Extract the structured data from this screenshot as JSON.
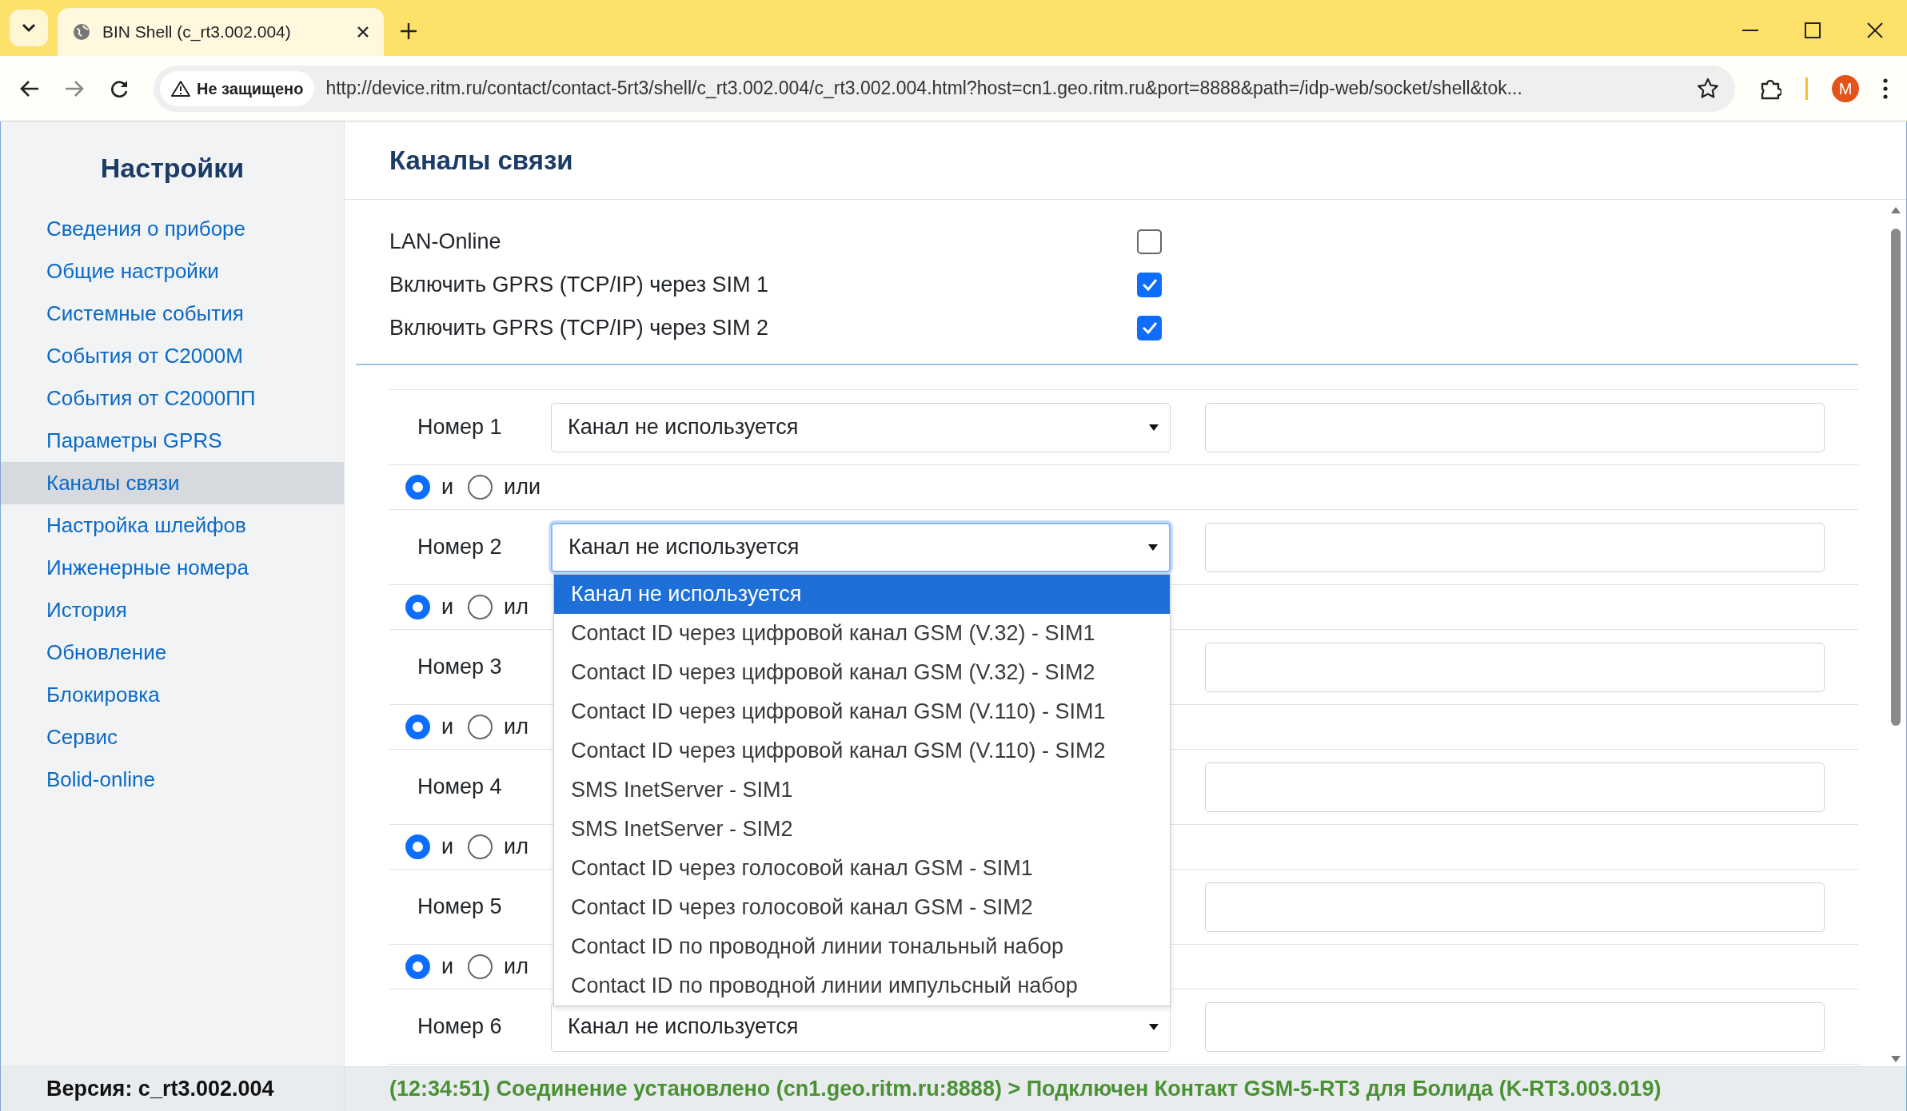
{
  "browser": {
    "tab_title": "BIN Shell (c_rt3.002.004)",
    "security": "Не защищено",
    "url": "http://device.ritm.ru/contact/contact-5rt3/shell/c_rt3.002.004/c_rt3.002.004.html?host=cn1.geo.ritm.ru&port=8888&path=/idp-web/socket/shell&tok...",
    "profile": "M"
  },
  "sidebar": {
    "title": "Настройки",
    "items": [
      {
        "label": "Сведения о приборе",
        "selected": false
      },
      {
        "label": "Общие настройки",
        "selected": false
      },
      {
        "label": "Системные события",
        "selected": false
      },
      {
        "label": "События от С2000М",
        "selected": false
      },
      {
        "label": "События от С2000ПП",
        "selected": false
      },
      {
        "label": "Параметры GPRS",
        "selected": false
      },
      {
        "label": "Каналы связи",
        "selected": true
      },
      {
        "label": "Настройка шлейфов",
        "selected": false
      },
      {
        "label": "Инженерные номера",
        "selected": false
      },
      {
        "label": "История",
        "selected": false
      },
      {
        "label": "Обновление",
        "selected": false
      },
      {
        "label": "Блокировка",
        "selected": false
      },
      {
        "label": "Сервис",
        "selected": false
      },
      {
        "label": "Bolid-online",
        "selected": false
      }
    ],
    "version": "Версия: c_rt3.002.004"
  },
  "page": {
    "title": "Каналы связи",
    "options": [
      {
        "label": "LAN-Online",
        "checked": false
      },
      {
        "label": "Включить GPRS (TCP/IP) через SIM 1",
        "checked": true
      },
      {
        "label": "Включить GPRS (TCP/IP) через SIM 2",
        "checked": true
      }
    ],
    "numbers": [
      {
        "label": "Номер 1",
        "select": {
          "value": "Канал не используется",
          "open": false
        },
        "logic": [
          {
            "label": "и",
            "selected": true
          },
          {
            "label": "или",
            "selected": false
          }
        ]
      },
      {
        "label": "Номер 2",
        "select": {
          "value": "Канал не используется",
          "open": true,
          "options": [
            {
              "label": "Канал не используется",
              "selected": true
            },
            {
              "label": "Contact ID через цифровой канал GSM (V.32) - SIM1",
              "selected": false
            },
            {
              "label": "Contact ID через цифровой канал GSM (V.32) - SIM2",
              "selected": false
            },
            {
              "label": "Contact ID через цифровой канал GSM (V.110) - SIM1",
              "selected": false
            },
            {
              "label": "Contact ID через цифровой канал GSM (V.110) - SIM2",
              "selected": false
            },
            {
              "label": "SMS InetServer - SIM1",
              "selected": false
            },
            {
              "label": "SMS InetServer - SIM2",
              "selected": false
            },
            {
              "label": "Contact ID через голосовой канал GSM - SIM1",
              "selected": false
            },
            {
              "label": "Contact ID через голосовой канал GSM - SIM2",
              "selected": false
            },
            {
              "label": "Contact ID по проводной линии тональный набор",
              "selected": false
            },
            {
              "label": "Contact ID по проводной линии импульсный набор",
              "selected": false
            }
          ]
        },
        "logic": [
          {
            "label": "и",
            "selected": true
          },
          {
            "label": "ил",
            "selected": false
          }
        ]
      },
      {
        "label": "Номер 3",
        "logic": [
          {
            "label": "и",
            "selected": true
          },
          {
            "label": "ил",
            "selected": false
          }
        ]
      },
      {
        "label": "Номер 4",
        "logic": [
          {
            "label": "и",
            "selected": true
          },
          {
            "label": "ил",
            "selected": false
          }
        ]
      },
      {
        "label": "Номер 5",
        "logic": [
          {
            "label": "и",
            "selected": true
          },
          {
            "label": "ил",
            "selected": false
          }
        ]
      },
      {
        "label": "Номер 6",
        "select": {
          "value": "Канал не используется",
          "open": false
        }
      }
    ],
    "status": "(12:34:51) Соединение установлено (cn1.geo.ritm.ru:8888) > Подключен Контакт GSM-5-RT3 для Болида (K-RT3.003.019)"
  }
}
